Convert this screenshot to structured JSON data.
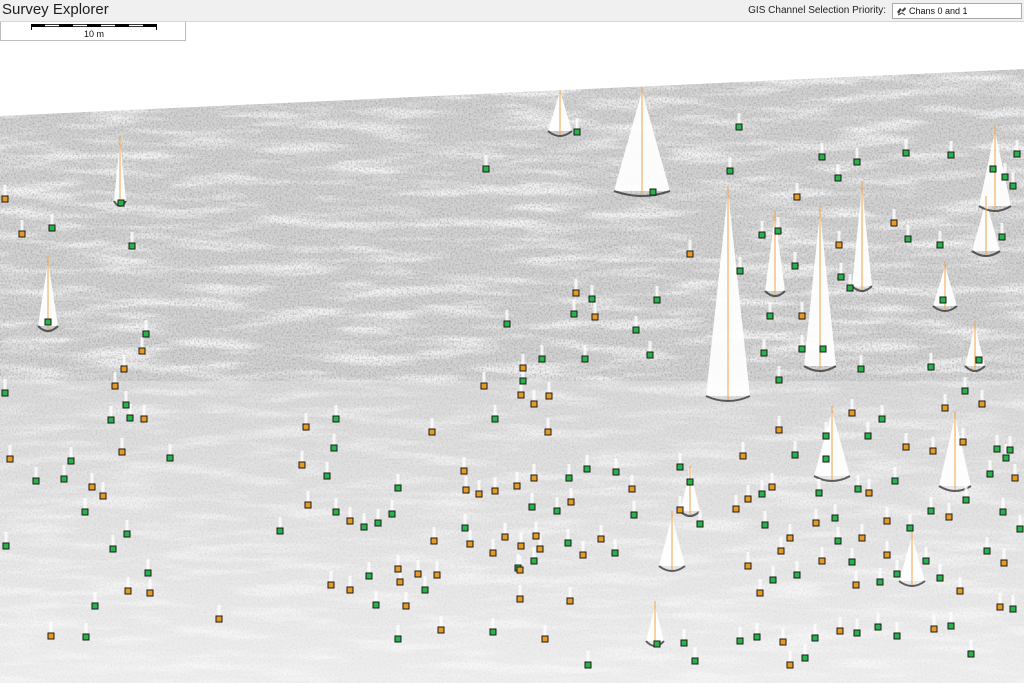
{
  "app": {
    "title": "Survey Explorer"
  },
  "gis": {
    "label": "GIS Channel Selection Priority:",
    "selected": "Chans 0 and 1",
    "icon": "channel-selection-icon"
  },
  "scale": {
    "label": "10 m"
  },
  "colors": {
    "contact_green": "#27b24a",
    "contact_orange": "#e69a1f",
    "track_line": "#f0a24a",
    "seabed": "#cfcfcf"
  }
}
